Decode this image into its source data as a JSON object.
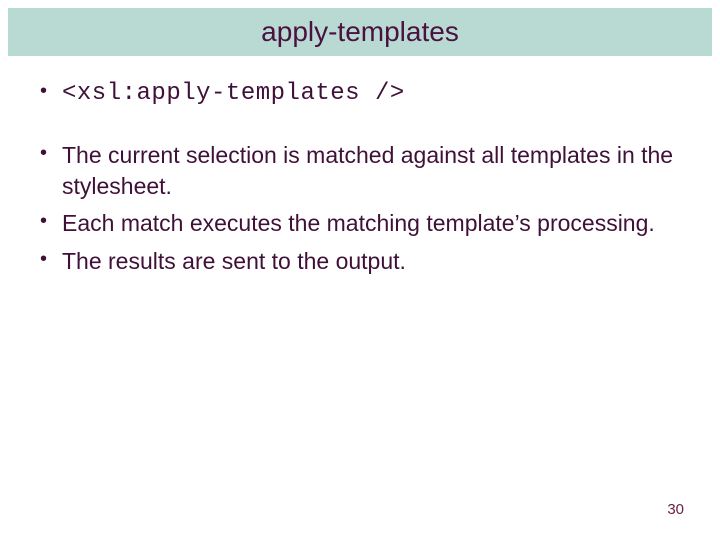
{
  "title": "apply-templates",
  "code_line": "<xsl:apply-templates />",
  "bullets": [
    "The current selection is matched against all templates in the stylesheet.",
    "Each match executes the matching template’s processing.",
    "The results are sent to the output."
  ],
  "page_number": "30"
}
